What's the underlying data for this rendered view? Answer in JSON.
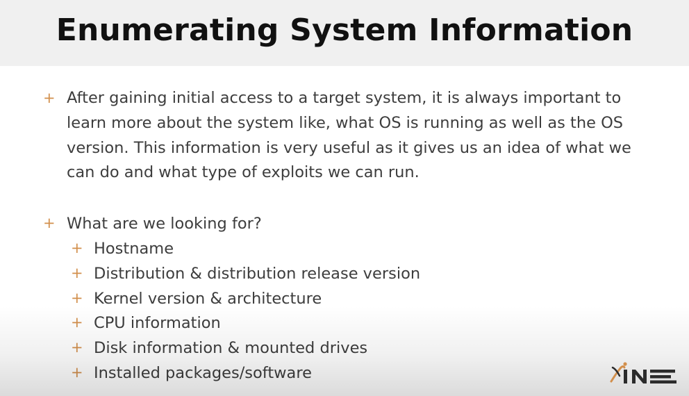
{
  "slide": {
    "title": "Enumerating System Information",
    "bullets": [
      {
        "lines": [
          "After gaining initial access to a target system, it is always important to",
          "learn more about the system like, what OS is running as well as the OS",
          "version. This information is very useful as it gives us an idea of what we",
          "can do and what type of exploits we can run."
        ]
      },
      {
        "text": "What are we looking for?",
        "sub_items": [
          "Hostname",
          "Distribution & distribution release version",
          "Kernel version & architecture",
          "CPU information",
          "Disk information & mounted drives",
          "Installed packages/software"
        ]
      }
    ],
    "bullet_glyph": "+",
    "accent_color": "#d28f4c",
    "logo": {
      "text": "INE",
      "icon": "ine-logo"
    }
  }
}
